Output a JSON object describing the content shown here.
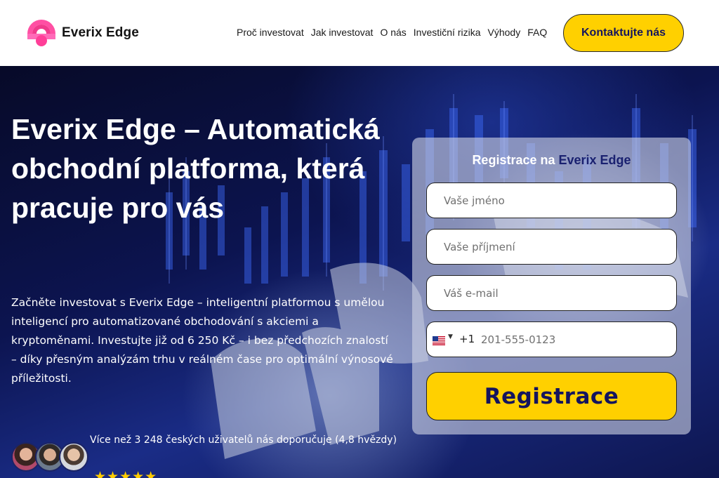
{
  "header": {
    "logo_text": "Everix Edge",
    "logo_icon": "rainbow-logo-icon",
    "nav": [
      "Proč investovat",
      "Jak investovat",
      "O nás",
      "Investiční rizika",
      "Výhody",
      "FAQ"
    ],
    "contact_label": "Kontaktujte nás"
  },
  "hero": {
    "title": "Everix Edge – Automatická obchodní platforma, která pracuje pro vás",
    "description": "Začněte investovat s Everix Edge – inteligentní platformou s umělou inteligencí pro automatizované obchodování s akciemi a kryptoměnami. Investujte již od 6 250 Kč – i bez předchozích znalostí – díky přesným analýzám trhu v reálném čase pro optimální výnosové příležitosti.",
    "proof_text": "Více než 3 248 českých uživatelů nás doporučuje (4,8 hvězdy)",
    "stars": "★★★★★",
    "rating": 4.8
  },
  "form": {
    "title_prefix": "Registrace na ",
    "title_brand": "Everix Edge",
    "first_name_placeholder": "Vaše jméno",
    "last_name_placeholder": "Vaše příjmení",
    "email_placeholder": "Váš e-mail",
    "phone_flag": "us-flag-icon",
    "phone_code": "+1",
    "phone_placeholder": "201-555-0123",
    "submit_label": "Registrace"
  },
  "colors": {
    "accent_yellow": "#ffd000",
    "brand_navy": "#1a2170",
    "logo_pink": "#f23c8f"
  }
}
